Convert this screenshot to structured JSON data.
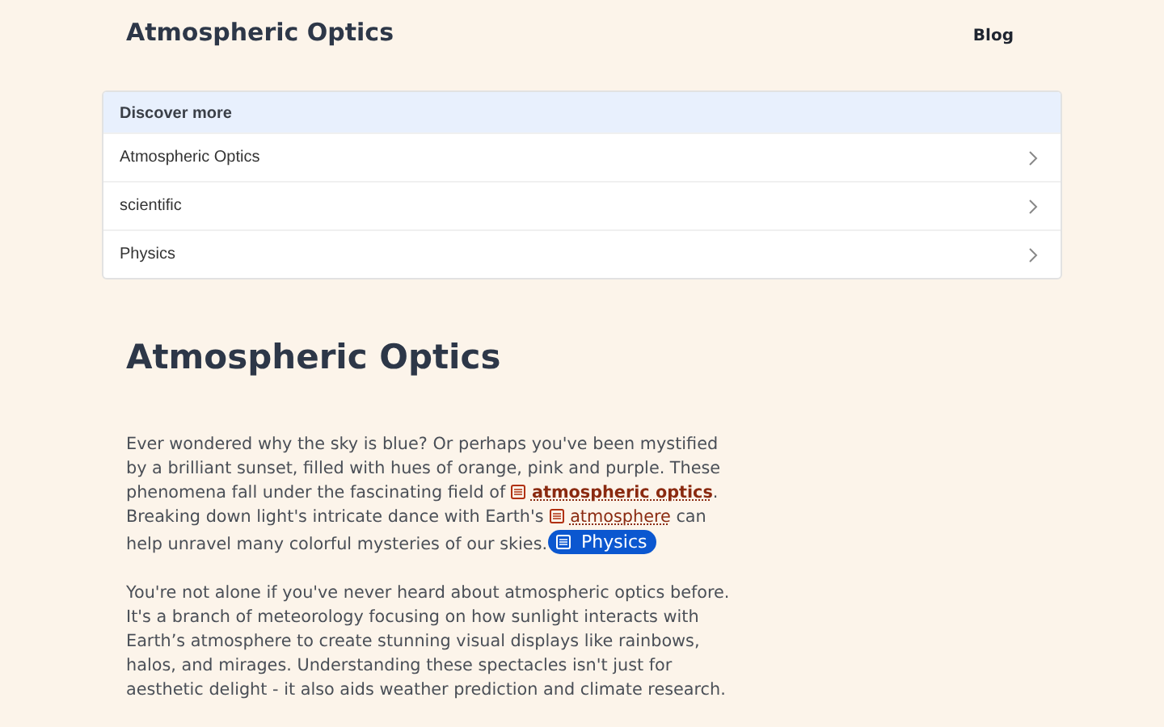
{
  "site_title": "Atmospheric Optics",
  "nav": [
    {
      "label": "Blog"
    }
  ],
  "discover": {
    "heading": "Discover more",
    "items": [
      {
        "label": "Atmospheric Optics"
      },
      {
        "label": "scientific"
      },
      {
        "label": "Physics"
      }
    ]
  },
  "article": {
    "title": "Atmospheric Optics",
    "paragraphs": [
      [
        {
          "kind": "text",
          "text": "Ever wondered why the sky is blue? Or perhaps you've been mystified by a brilliant sunset, filled with hues of orange, pink and purple. These phenomena fall under the fascinating field of "
        },
        {
          "kind": "link",
          "text": "atmospheric optics",
          "bold": true
        },
        {
          "kind": "text",
          "text": ". Breaking down light's intricate dance with Earth's "
        },
        {
          "kind": "link",
          "text": "atmosphere",
          "bold": false
        },
        {
          "kind": "text",
          "text": " can help unravel many colorful mysteries of our skies."
        },
        {
          "kind": "chip",
          "text": "Physics"
        }
      ],
      [
        {
          "kind": "text",
          "text": "You're not alone if you've never heard about atmospheric optics before. It's a branch of meteorology focusing on how sunlight interacts with Earth’s atmosphere to create stunning visual displays like rainbows, halos, and mirages. Understanding these spectacles isn't just for aesthetic delight - it also aids weather prediction and climate research."
        }
      ]
    ]
  }
}
